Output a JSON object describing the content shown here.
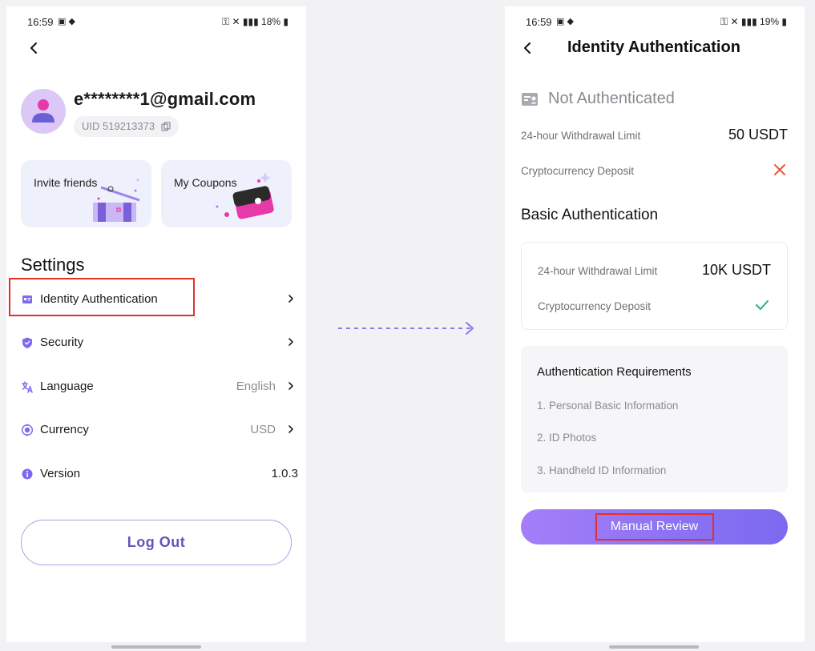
{
  "colors": {
    "accent": "#7b6af0",
    "highlight": "#e0322b",
    "negative": "#e8573a",
    "positive": "#28b27a"
  },
  "left": {
    "status_bar": {
      "time": "16:59",
      "battery": "18%"
    },
    "profile": {
      "email": "e********1@gmail.com",
      "uid": "UID 519213373"
    },
    "cards": {
      "invite": "Invite friends",
      "coupons": "My Coupons"
    },
    "settings_title": "Settings",
    "settings": [
      {
        "label": "Identity Authentication",
        "value": "",
        "icon": "id-card-icon"
      },
      {
        "label": "Security",
        "value": "",
        "icon": "shield-icon"
      },
      {
        "label": "Language",
        "value": "English",
        "icon": "language-icon"
      },
      {
        "label": "Currency",
        "value": "USD",
        "icon": "currency-icon"
      },
      {
        "label": "Version",
        "value": "1.0.3",
        "icon": "info-icon"
      }
    ],
    "logout": "Log Out"
  },
  "right": {
    "status_bar": {
      "time": "16:59",
      "battery": "19%"
    },
    "title": "Identity Authentication",
    "status": "Not Authenticated",
    "current": {
      "withdrawal_label": "24-hour Withdrawal Limit",
      "withdrawal_value": "50 USDT",
      "deposit_label": "Cryptocurrency Deposit"
    },
    "basic": {
      "title": "Basic Authentication",
      "withdrawal_label": "24-hour Withdrawal Limit",
      "withdrawal_value": "10K USDT",
      "deposit_label": "Cryptocurrency Deposit"
    },
    "requirements": {
      "title": "Authentication Requirements",
      "items": [
        "1. Personal Basic Information",
        "2. ID Photos",
        "3. Handheld ID Information"
      ]
    },
    "button": "Manual Review"
  }
}
